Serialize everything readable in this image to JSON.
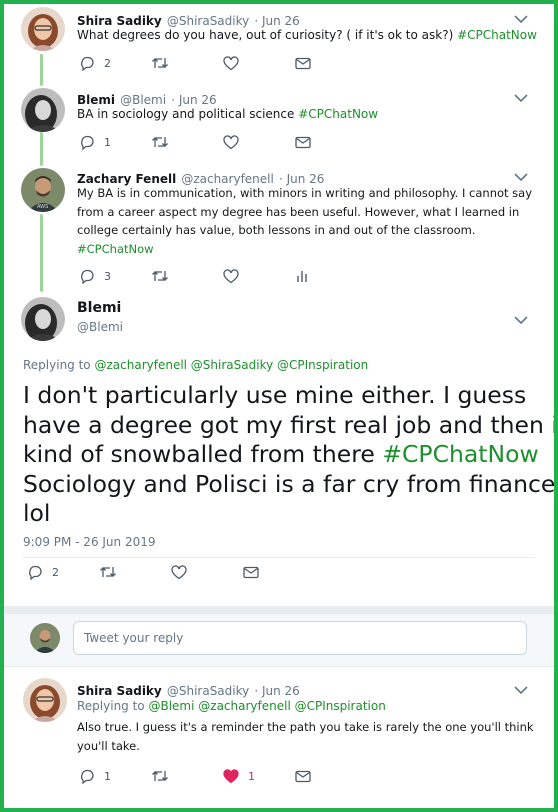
{
  "tweets": [
    {
      "name": "Shira Sadiky",
      "handle": "@ShiraSadiky",
      "date": "· Jun 26",
      "text": "What degrees do you have, out of curiosity? ( if it's ok to ask?)",
      "hashtag": "#CPChatNow",
      "reply_count": "2",
      "retweet_count": "",
      "like_count": ""
    },
    {
      "name": "Blemi",
      "handle": "@Blemi",
      "date": "· Jun 26",
      "text": "BA in sociology and political science",
      "hashtag": "#CPChatNow",
      "reply_count": "1",
      "retweet_count": "",
      "like_count": ""
    },
    {
      "name": "Zachary Fenell",
      "handle": "@zacharyfenell",
      "date": "· Jun 26",
      "lines": [
        "My BA is in communication, with minors in writing and philosophy. I cannot say",
        "from a career aspect my degree has been useful. However, what I learned in",
        "college certainly has value, both lessons in and out of the classroom."
      ],
      "hashtag": "#CPChatNow",
      "reply_count": "3",
      "retweet_count": "",
      "like_count": ""
    }
  ],
  "focused": {
    "name": "Blemi",
    "handle": "@Blemi",
    "replying_label": "Replying to",
    "replying_to": "@zacharyfenell @ShiraSadiky @CPInspiration",
    "lines": [
      "I don't particularly use mine either. I guess",
      "have a degree got my first real job and then i",
      "kind of snowballed from there"
    ],
    "hashtag": "#CPChatNow",
    "lines_after": [
      "Sociology and Polisci is a far cry from finance",
      "lol"
    ],
    "timestamp": "9:09 PM - 26 Jun 2019",
    "reply_count": "2"
  },
  "composer": {
    "placeholder": "Tweet your reply"
  },
  "reply": {
    "name": "Shira Sadiky",
    "handle": "@ShiraSadiky",
    "date": "· Jun 26",
    "replying_label": "Replying to",
    "replying_to": "@Blemi @zacharyfenell @CPInspiration",
    "lines": [
      "Also true. I guess it's a reminder the path you take is rarely the one you'll think",
      "you'll take."
    ],
    "reply_count": "1",
    "like_count": "1"
  },
  "colors": {
    "frame": "#22b14c",
    "hashtag": "#1d8f2b",
    "like_active": "#e0245e"
  }
}
